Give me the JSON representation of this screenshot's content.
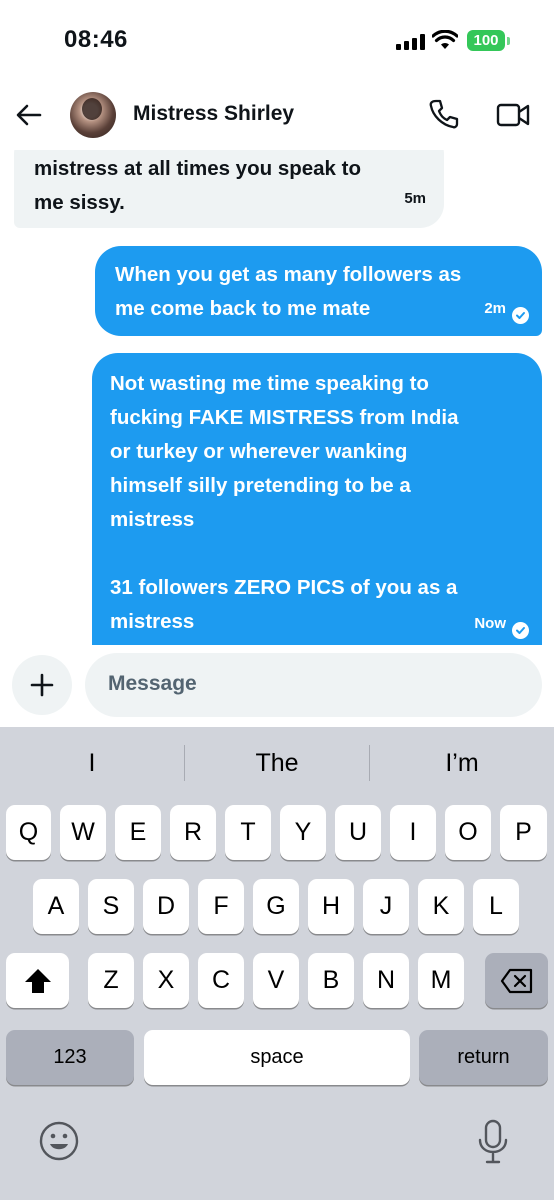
{
  "status_bar": {
    "time": "08:46",
    "battery": "100"
  },
  "header": {
    "contact_name": "Mistress Shirley"
  },
  "messages": [
    {
      "direction": "incoming",
      "text": "mistress at all times you speak to\nme sissy.",
      "time": "5m"
    },
    {
      "direction": "outgoing",
      "text": "When you get as many followers as\nme come back to me mate",
      "time": "2m"
    },
    {
      "direction": "outgoing",
      "text": "Not wasting me time speaking to\nfucking FAKE MISTRESS from India\nor turkey or wherever wanking\nhimself silly pretending to be a\nmistress\n\n31 followers ZERO PICS of you as a\nmistress",
      "time": "Now"
    }
  ],
  "composer": {
    "placeholder": "Message"
  },
  "keyboard": {
    "suggestions": [
      "I",
      "The",
      "I’m"
    ],
    "row1": [
      "Q",
      "W",
      "E",
      "R",
      "T",
      "Y",
      "U",
      "I",
      "O",
      "P"
    ],
    "row2": [
      "A",
      "S",
      "D",
      "F",
      "G",
      "H",
      "J",
      "K",
      "L"
    ],
    "row3": [
      "Z",
      "X",
      "C",
      "V",
      "B",
      "N",
      "M"
    ],
    "numbers_label": "123",
    "space_label": "space",
    "return_label": "return"
  },
  "icons": {
    "back": "arrow-left-icon",
    "call": "phone-icon",
    "video": "video-camera-icon",
    "plus": "plus-icon",
    "shift": "shift-icon",
    "delete": "backspace-icon",
    "emoji": "emoji-icon",
    "mic": "microphone-icon",
    "read": "check-circle-icon"
  },
  "colors": {
    "accent": "#1d9bf0",
    "incoming_bubble": "#eff3f4",
    "battery": "#34c759",
    "keyboard_bg": "#d1d4db"
  }
}
